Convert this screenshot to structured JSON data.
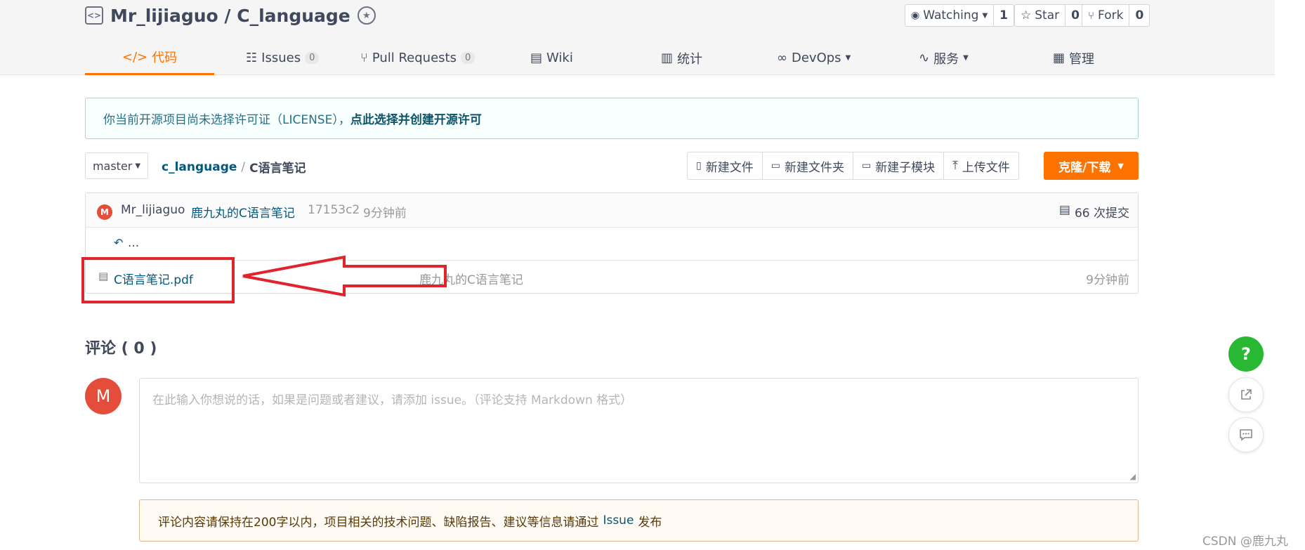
{
  "header": {
    "repo_name": "Mr_lijiaguo / C_language",
    "watching_label": "Watching",
    "watching_count": "1",
    "star_label": "Star",
    "star_count": "0",
    "fork_label": "Fork",
    "fork_count": "0"
  },
  "tabs": [
    {
      "label": "代码",
      "active": true
    },
    {
      "label": "Issues",
      "count": "0"
    },
    {
      "label": "Pull Requests",
      "count": "0"
    },
    {
      "label": "Wiki"
    },
    {
      "label": "统计"
    },
    {
      "label": "DevOps"
    },
    {
      "label": "服务"
    },
    {
      "label": "管理"
    }
  ],
  "notice": {
    "text": "你当前开源项目尚未选择许可证（LICENSE），",
    "link": "点此选择并创建开源许可"
  },
  "branch": "master",
  "breadcrumb": {
    "root": "c_language",
    "sep": "/",
    "current": "C语言笔记"
  },
  "actions": {
    "new_file": "新建文件",
    "new_folder": "新建文件夹",
    "new_submodule": "新建子模块",
    "upload": "上传文件",
    "clone": "克隆/下载"
  },
  "commit": {
    "avatar": "M",
    "author": "Mr_lijiaguo",
    "message": "鹿九丸的C语言笔记",
    "hash": "17153c2",
    "time": "9分钟前",
    "count_label": "66 次提交"
  },
  "files": {
    "parent": "...",
    "rows": [
      {
        "name": "C语言笔记.pdf",
        "message": "鹿九丸的C语言笔记",
        "time": "9分钟前"
      }
    ]
  },
  "comments": {
    "title": "评论 ( 0 )",
    "avatar": "M",
    "placeholder": "在此输入你想说的话，如果是问题或者建议，请添加 issue。（评论支持 Markdown 格式）",
    "warn_pre": "评论内容请保持在200字以内，项目相关的技术问题、缺陷报告、建议等信息请通过",
    "warn_link": "Issue",
    "warn_post": "发布"
  },
  "fab": {
    "help": "?"
  },
  "watermark": "CSDN @鹿九丸",
  "colors": {
    "accent": "#fe7300",
    "link": "#005980",
    "annotation": "#e0242b",
    "help": "#28b833"
  }
}
